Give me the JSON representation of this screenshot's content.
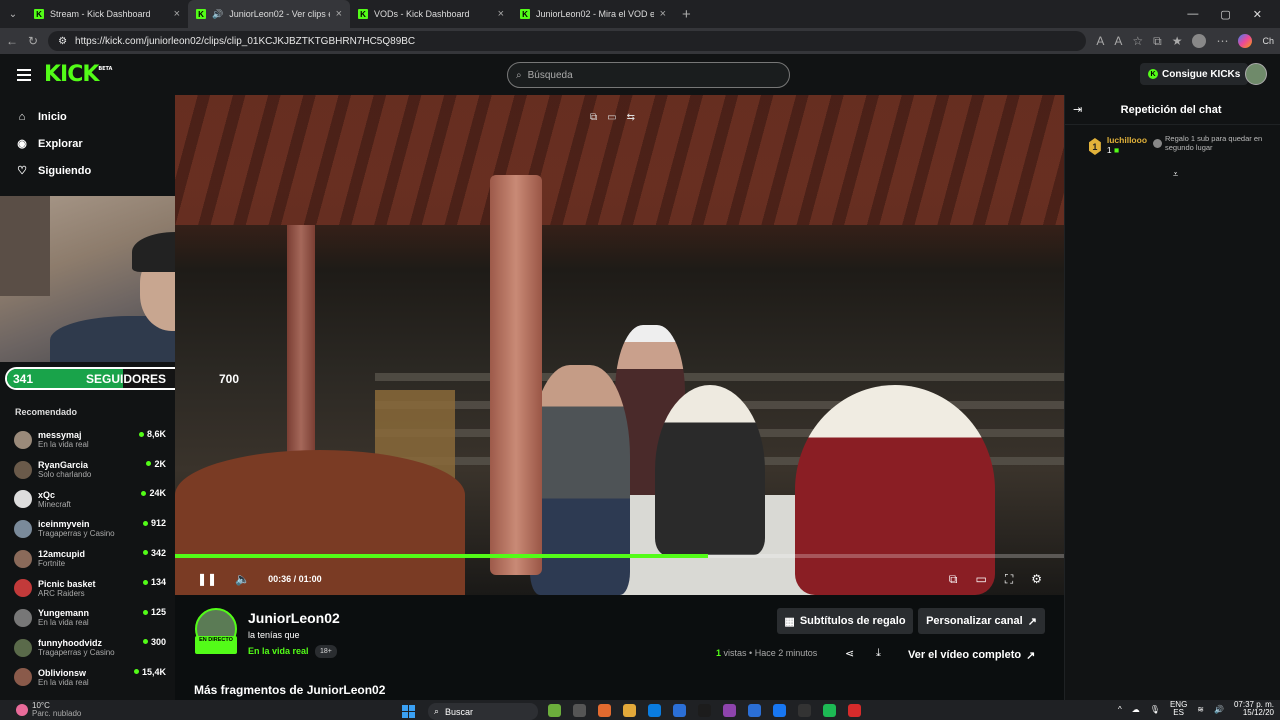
{
  "browser": {
    "tabs": [
      {
        "label": "Stream - Kick Dashboard",
        "active": false
      },
      {
        "label": "JuniorLeon02 - Ver clips en Ki",
        "active": true
      },
      {
        "label": "VODs - Kick Dashboard",
        "active": false
      },
      {
        "label": "JuniorLeon02 - Mira el VOD en Kic",
        "active": false
      }
    ],
    "url": "https://kick.com/juniorleon02/clips/clip_01KCJKJBZTKTGBHRN7HC5Q89BC",
    "profile_label": "Ch"
  },
  "header": {
    "logo": "KICK",
    "logo_beta": "BETA",
    "search_placeholder": "Búsqueda",
    "kicks_button": "Consigue KICKs"
  },
  "sidebar": {
    "nav": [
      {
        "label": "Inicio",
        "icon": "home-icon"
      },
      {
        "label": "Explorar",
        "icon": "compass-icon"
      },
      {
        "label": "Siguiendo",
        "icon": "heart-icon"
      }
    ],
    "followers_goal": {
      "current": "341",
      "label": "SEGUIDORES",
      "target": "700",
      "fraction": 0.487
    },
    "recommended_title": "Recomendado",
    "recommended": [
      {
        "name": "messymaj",
        "category": "En la vida real",
        "viewers": "8,6K",
        "color": "#9a8a7a"
      },
      {
        "name": "RyanGarcia",
        "category": "Solo charlando",
        "viewers": "2K",
        "color": "#6a5a4a"
      },
      {
        "name": "xQc",
        "category": "Minecraft",
        "viewers": "24K",
        "color": "#ddd"
      },
      {
        "name": "iceinmyvein",
        "category": "Tragaperras y Casino",
        "viewers": "912",
        "color": "#7a8a9a"
      },
      {
        "name": "12amcupid",
        "category": "Fortnite",
        "viewers": "342",
        "color": "#8a6a5a"
      },
      {
        "name": "Picnic basket",
        "category": "ARC Raiders",
        "viewers": "134",
        "color": "#c23a3a"
      },
      {
        "name": "Yungemann",
        "category": "En la vida real",
        "viewers": "125",
        "color": "#777"
      },
      {
        "name": "funnyhoodvidz",
        "category": "Tragaperras y Casino",
        "viewers": "300",
        "color": "#5a6a4a"
      },
      {
        "name": "Oblivionsw",
        "category": "En la vida real",
        "viewers": "15,4K",
        "color": "#8a5a4a"
      }
    ]
  },
  "player": {
    "current_time": "00:36",
    "duration": "01:00",
    "progress": 0.6
  },
  "channel": {
    "name": "JuniorLeon02",
    "clip_title": "la tenías que",
    "category": "En la vida real",
    "age_rating": "18+",
    "live_badge": "EN DIRECTO",
    "gift_subs_button": "Subtítulos de regalo",
    "customize_button": "Personalizar canal",
    "views_count": "1",
    "views_label": "vistas",
    "time_ago": "Hace 2 minutos",
    "full_video_button": "Ver el vídeo completo",
    "more_clips_title": "Más fragmentos de JuniorLeon02"
  },
  "chat": {
    "title": "Repetición del chat",
    "gift": {
      "badge": "1",
      "user": "luchillooo",
      "count": "1",
      "message": "Regalo 1 sub para quedar en segundo lugar"
    }
  },
  "taskbar": {
    "temperature": "10°C",
    "weather": "Parc. nublado",
    "search": "Buscar",
    "lang_top": "ENG",
    "lang_bottom": "ES",
    "time": "07:37 p. m.",
    "date": "15/12/20"
  }
}
